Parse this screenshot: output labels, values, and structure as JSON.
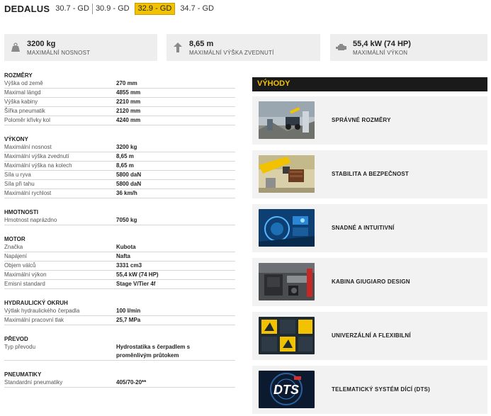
{
  "header": {
    "brand": "DEDALUS",
    "models": [
      "30.7 - GD",
      "30.9 - GD",
      "32.9 - GD",
      "34.7 - GD"
    ],
    "active_model": "32.9 - GD"
  },
  "stats": [
    {
      "value": "3200 kg",
      "label": "MAXIMÁLNÍ NOSNOST",
      "icon": "weight-icon"
    },
    {
      "value": "8,65 m",
      "label": "MAXIMÁLNÍ VÝŠKA ZVEDNUTÍ",
      "icon": "arrow-up-icon"
    },
    {
      "value": "55,4 kW (74 HP)",
      "label": "MAXIMÁLNÍ VÝKON",
      "icon": "engine-icon"
    }
  ],
  "specs": {
    "rozmery": {
      "title": "ROZMĚRY",
      "rows": [
        {
          "k": "Výška od země",
          "v": "270 mm"
        },
        {
          "k": "Maximal längd",
          "v": "4855 mm"
        },
        {
          "k": "Výška kabiny",
          "v": "2210 mm"
        },
        {
          "k": "Šířka pneumatik",
          "v": "2120 mm"
        },
        {
          "k": "Poloměr křivky kol",
          "v": "4240 mm"
        }
      ]
    },
    "vykony": {
      "title": "VÝKONY",
      "rows": [
        {
          "k": "Maximální nosnost",
          "v": "3200 kg"
        },
        {
          "k": "Maximální výška zvednutí",
          "v": "8,65 m"
        },
        {
          "k": "Maximální výška na kolech",
          "v": "8,65 m"
        },
        {
          "k": "Síla u ryva",
          "v": "5800 daN"
        },
        {
          "k": "Síla při tahu",
          "v": "5800 daN"
        },
        {
          "k": "Maximální rychlost",
          "v": "36 km/h"
        }
      ]
    },
    "hmotnosti": {
      "title": "HMOTNOSTI",
      "rows": [
        {
          "k": "Hmotnost naprázdno",
          "v": "7050 kg"
        }
      ]
    },
    "motor": {
      "title": "MOTOR",
      "rows": [
        {
          "k": "Značka",
          "v": "Kubota"
        },
        {
          "k": "Napájení",
          "v": "Nafta"
        },
        {
          "k": "Objem válců",
          "v": "3331 cm3"
        },
        {
          "k": "Maximální výkon",
          "v": "55,4 kW (74 HP)"
        },
        {
          "k": "Emisní standard",
          "v": "Stage V/Tier 4f"
        }
      ]
    },
    "hydraulika": {
      "title": "HYDRAULICKÝ OKRUH",
      "rows": [
        {
          "k": "Výtlak hydraulického čerpadla",
          "v": "100 l/min"
        },
        {
          "k": "Maximální pracovní tlak",
          "v": "25,7 MPa"
        }
      ]
    },
    "prevod": {
      "title": "PŘEVOD",
      "rows": [
        {
          "k": "Typ převodu",
          "v": "Hydrostatika s čerpadlem s",
          "v2": "proměnlivým průtokem"
        }
      ]
    },
    "pneumatiky": {
      "title": "PNEUMATIKY",
      "rows": [
        {
          "k": "Standardní pneumatiky",
          "v": "405/70-20**"
        }
      ]
    }
  },
  "advantages": {
    "title": "VÝHODY",
    "items": [
      {
        "label": "SPRÁVNÉ ROZMĚRY"
      },
      {
        "label": "STABILITA A BEZPEČNOST"
      },
      {
        "label": "SNADNÉ A INTUITIVNÍ"
      },
      {
        "label": "KABINA GIUGIARO DESIGN"
      },
      {
        "label": "UNIVERZÁLNÍ A FLEXIBILNÍ"
      },
      {
        "label": "TELEMATICKÝ SYSTÉM DÍCÍ (DTS)",
        "thumb_text": "DTS"
      }
    ]
  },
  "colors": {
    "accent": "#f2c200",
    "dark": "#1a1a1a",
    "box_bg": "#eeeeee"
  }
}
